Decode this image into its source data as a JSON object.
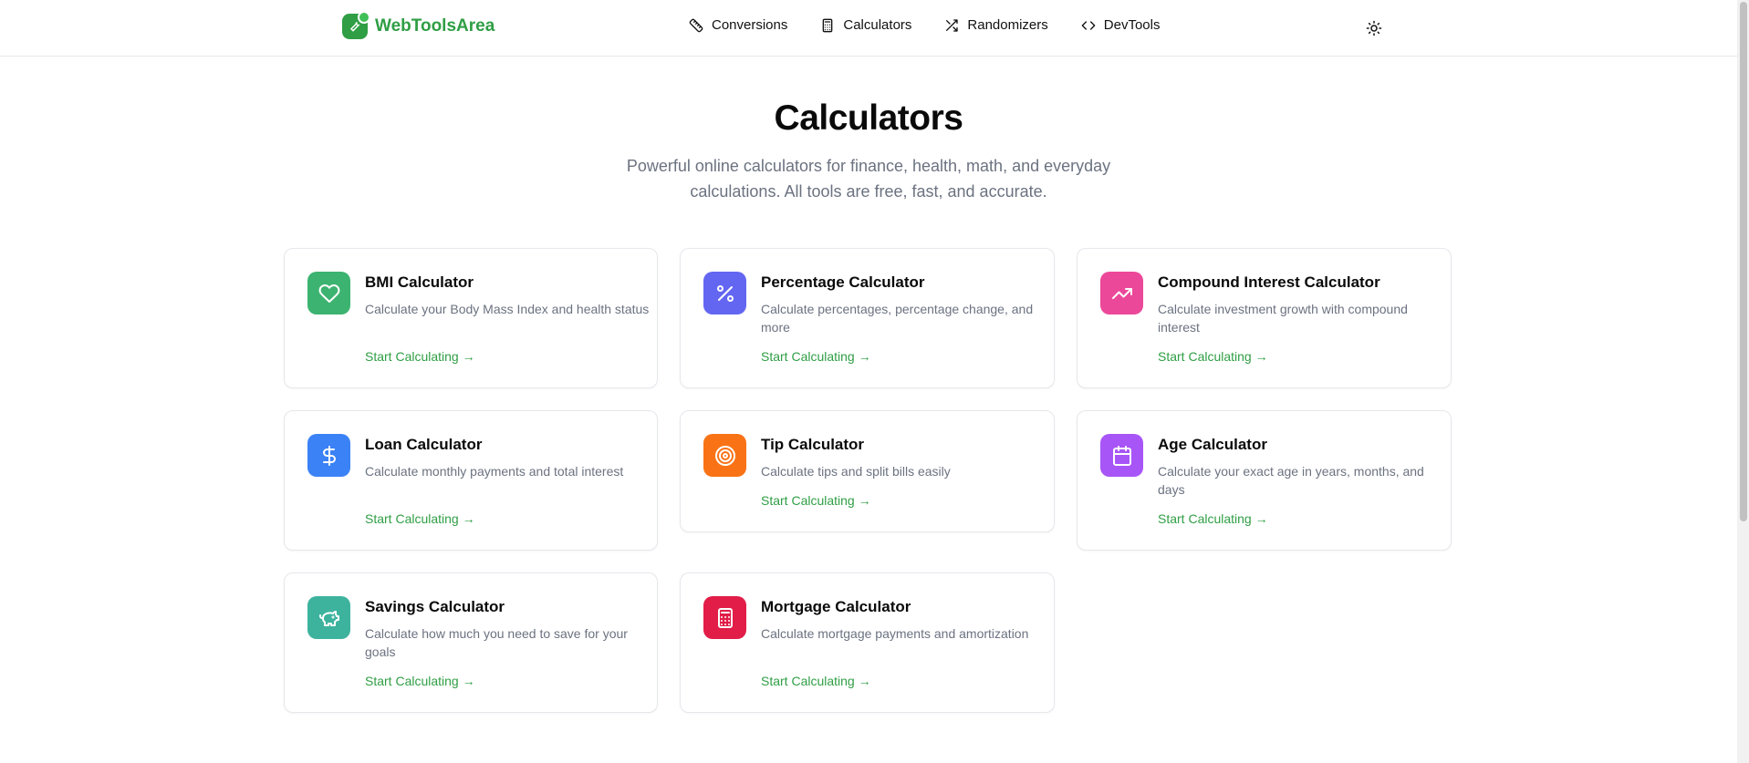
{
  "brand": {
    "name": "WebToolsArea",
    "color": "#2f9e44",
    "icon": "wrench-icon"
  },
  "nav": [
    {
      "label": "Conversions",
      "icon": "ruler-icon"
    },
    {
      "label": "Calculators",
      "icon": "calculator-icon"
    },
    {
      "label": "Randomizers",
      "icon": "shuffle-icon"
    },
    {
      "label": "DevTools",
      "icon": "code-icon"
    }
  ],
  "theme_toggle": {
    "icon": "sun-icon"
  },
  "hero": {
    "title": "Calculators",
    "subtitle": "Powerful online calculators for finance, health, math, and everyday calculations. All tools are free, fast, and accurate."
  },
  "cards": [
    {
      "title": "BMI Calculator",
      "description": "Calculate your Body Mass Index and health status",
      "link": "Start Calculating →",
      "icon": "heart-icon",
      "color": "#3cb371"
    },
    {
      "title": "Percentage Calculator",
      "description": "Calculate percentages, percentage change, and more",
      "link": "Start Calculating →",
      "icon": "percent-icon",
      "color": "#6366f1"
    },
    {
      "title": "Compound Interest Calculator",
      "description": "Calculate investment growth with compound interest",
      "link": "Start Calculating →",
      "icon": "trending-up-icon",
      "color": "#ec4899"
    },
    {
      "title": "Loan Calculator",
      "description": "Calculate monthly payments and total interest",
      "link": "Start Calculating →",
      "icon": "dollar-icon",
      "color": "#3b82f6"
    },
    {
      "title": "Tip Calculator",
      "description": "Calculate tips and split bills easily",
      "link": "Start Calculating →",
      "icon": "target-icon",
      "color": "#f97316"
    },
    {
      "title": "Age Calculator",
      "description": "Calculate your exact age in years, months, and days",
      "link": "Start Calculating →",
      "icon": "calendar-icon",
      "color": "#a855f7"
    },
    {
      "title": "Savings Calculator",
      "description": "Calculate how much you need to save for your goals",
      "link": "Start Calculating →",
      "icon": "piggy-bank-icon",
      "color": "#3db39e"
    },
    {
      "title": "Mortgage Calculator",
      "description": "Calculate mortgage payments and amortization",
      "link": "Start Calculating →",
      "icon": "calculator-icon",
      "color": "#e11d48"
    }
  ]
}
